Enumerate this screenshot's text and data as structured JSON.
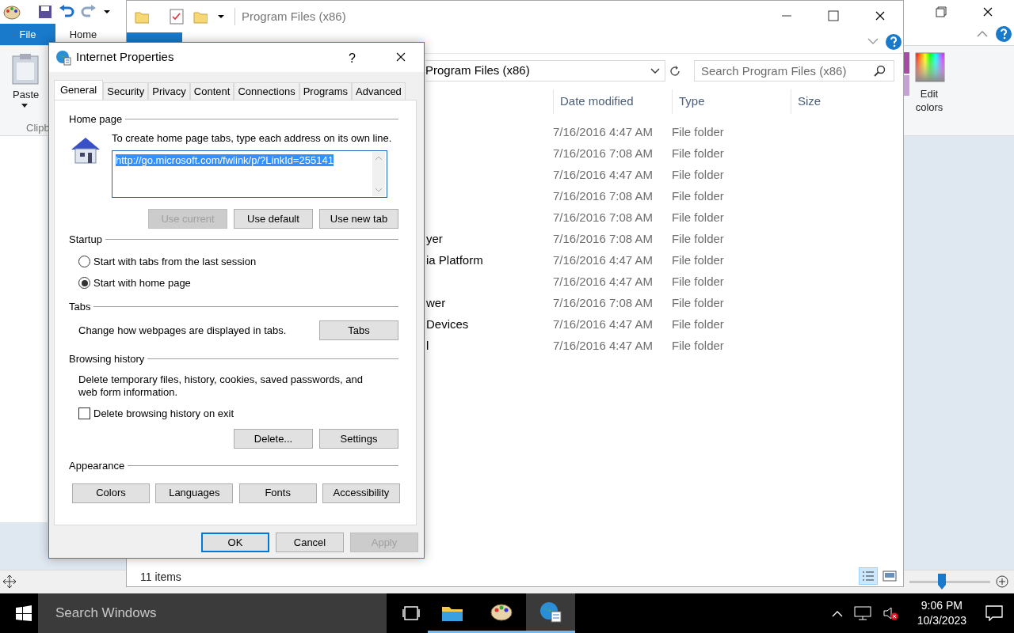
{
  "paint": {
    "tabs": [
      {
        "label": "File",
        "selected": true
      },
      {
        "label": "Home",
        "selected": false
      }
    ],
    "paste": "Paste",
    "group": "Clipb",
    "edit_colors": "Edit colors",
    "zoom": {
      "level": 0.4
    }
  },
  "explorer": {
    "title": "Program Files (x86)",
    "address": "Program Files (x86)",
    "search": {
      "placeholder": "Search Program Files (x86)"
    },
    "columns": [
      "Date modified",
      "Type",
      "Size"
    ],
    "rows": [
      {
        "date": "7/16/2016 4:47 AM",
        "type": "File folder"
      },
      {
        "date": "7/16/2016 7:08 AM",
        "type": "File folder"
      },
      {
        "date": "7/16/2016 4:47 AM",
        "type": "File folder"
      },
      {
        "date": "7/16/2016 7:08 AM",
        "type": "File folder"
      },
      {
        "date": "7/16/2016 7:08 AM",
        "type": "File folder"
      },
      {
        "name": "yer",
        "date": "7/16/2016 7:08 AM",
        "type": "File folder"
      },
      {
        "name": "ia Platform",
        "date": "7/16/2016 4:47 AM",
        "type": "File folder"
      },
      {
        "date": "7/16/2016 4:47 AM",
        "type": "File folder"
      },
      {
        "name": "wer",
        "date": "7/16/2016 7:08 AM",
        "type": "File folder"
      },
      {
        "name": "Devices",
        "date": "7/16/2016 4:47 AM",
        "type": "File folder"
      },
      {
        "name": "l",
        "date": "7/16/2016 4:47 AM",
        "type": "File folder"
      }
    ],
    "status": "11 items"
  },
  "dialog": {
    "title": "Internet Properties",
    "help": "?",
    "tabs": [
      {
        "label": "General",
        "selected": true
      },
      {
        "label": "Security",
        "selected": false
      },
      {
        "label": "Privacy",
        "selected": false
      },
      {
        "label": "Content",
        "selected": false
      },
      {
        "label": "Connections",
        "selected": false
      },
      {
        "label": "Programs",
        "selected": false
      },
      {
        "label": "Advanced",
        "selected": false
      }
    ],
    "home_page": {
      "heading": "Home page",
      "hint": "To create home page tabs, type each address on its own line.",
      "value": "http://go.microsoft.com/fwlink/p/?LinkId=255141",
      "buttons": [
        {
          "label": "Use current",
          "disabled": true
        },
        {
          "label": "Use default",
          "disabled": false
        },
        {
          "label": "Use new tab",
          "disabled": false
        }
      ]
    },
    "startup": {
      "heading": "Startup",
      "options": [
        {
          "label": "Start with tabs from the last session",
          "selected": false
        },
        {
          "label": "Start with home page",
          "selected": true
        }
      ]
    },
    "tabs_section": {
      "heading": "Tabs",
      "text": "Change how webpages are displayed in tabs.",
      "button": "Tabs"
    },
    "history": {
      "heading": "Browsing history",
      "text": "Delete temporary files, history, cookies, saved passwords, and web form information.",
      "checkbox": {
        "label": "Delete browsing history on exit",
        "checked": false
      },
      "buttons": [
        "Delete...",
        "Settings"
      ]
    },
    "appearance": {
      "heading": "Appearance",
      "buttons": [
        "Colors",
        "Languages",
        "Fonts",
        "Accessibility"
      ]
    },
    "footer": [
      {
        "label": "OK",
        "disabled": false
      },
      {
        "label": "Cancel",
        "disabled": false
      },
      {
        "label": "Apply",
        "disabled": true
      }
    ]
  },
  "taskbar": {
    "search_placeholder": "Search Windows",
    "apps": [
      {
        "kind": "folder",
        "selected": false
      },
      {
        "kind": "paint",
        "selected": false
      },
      {
        "kind": "globe",
        "selected": true
      }
    ],
    "time": "9:06 PM",
    "date": "10/3/2023"
  }
}
